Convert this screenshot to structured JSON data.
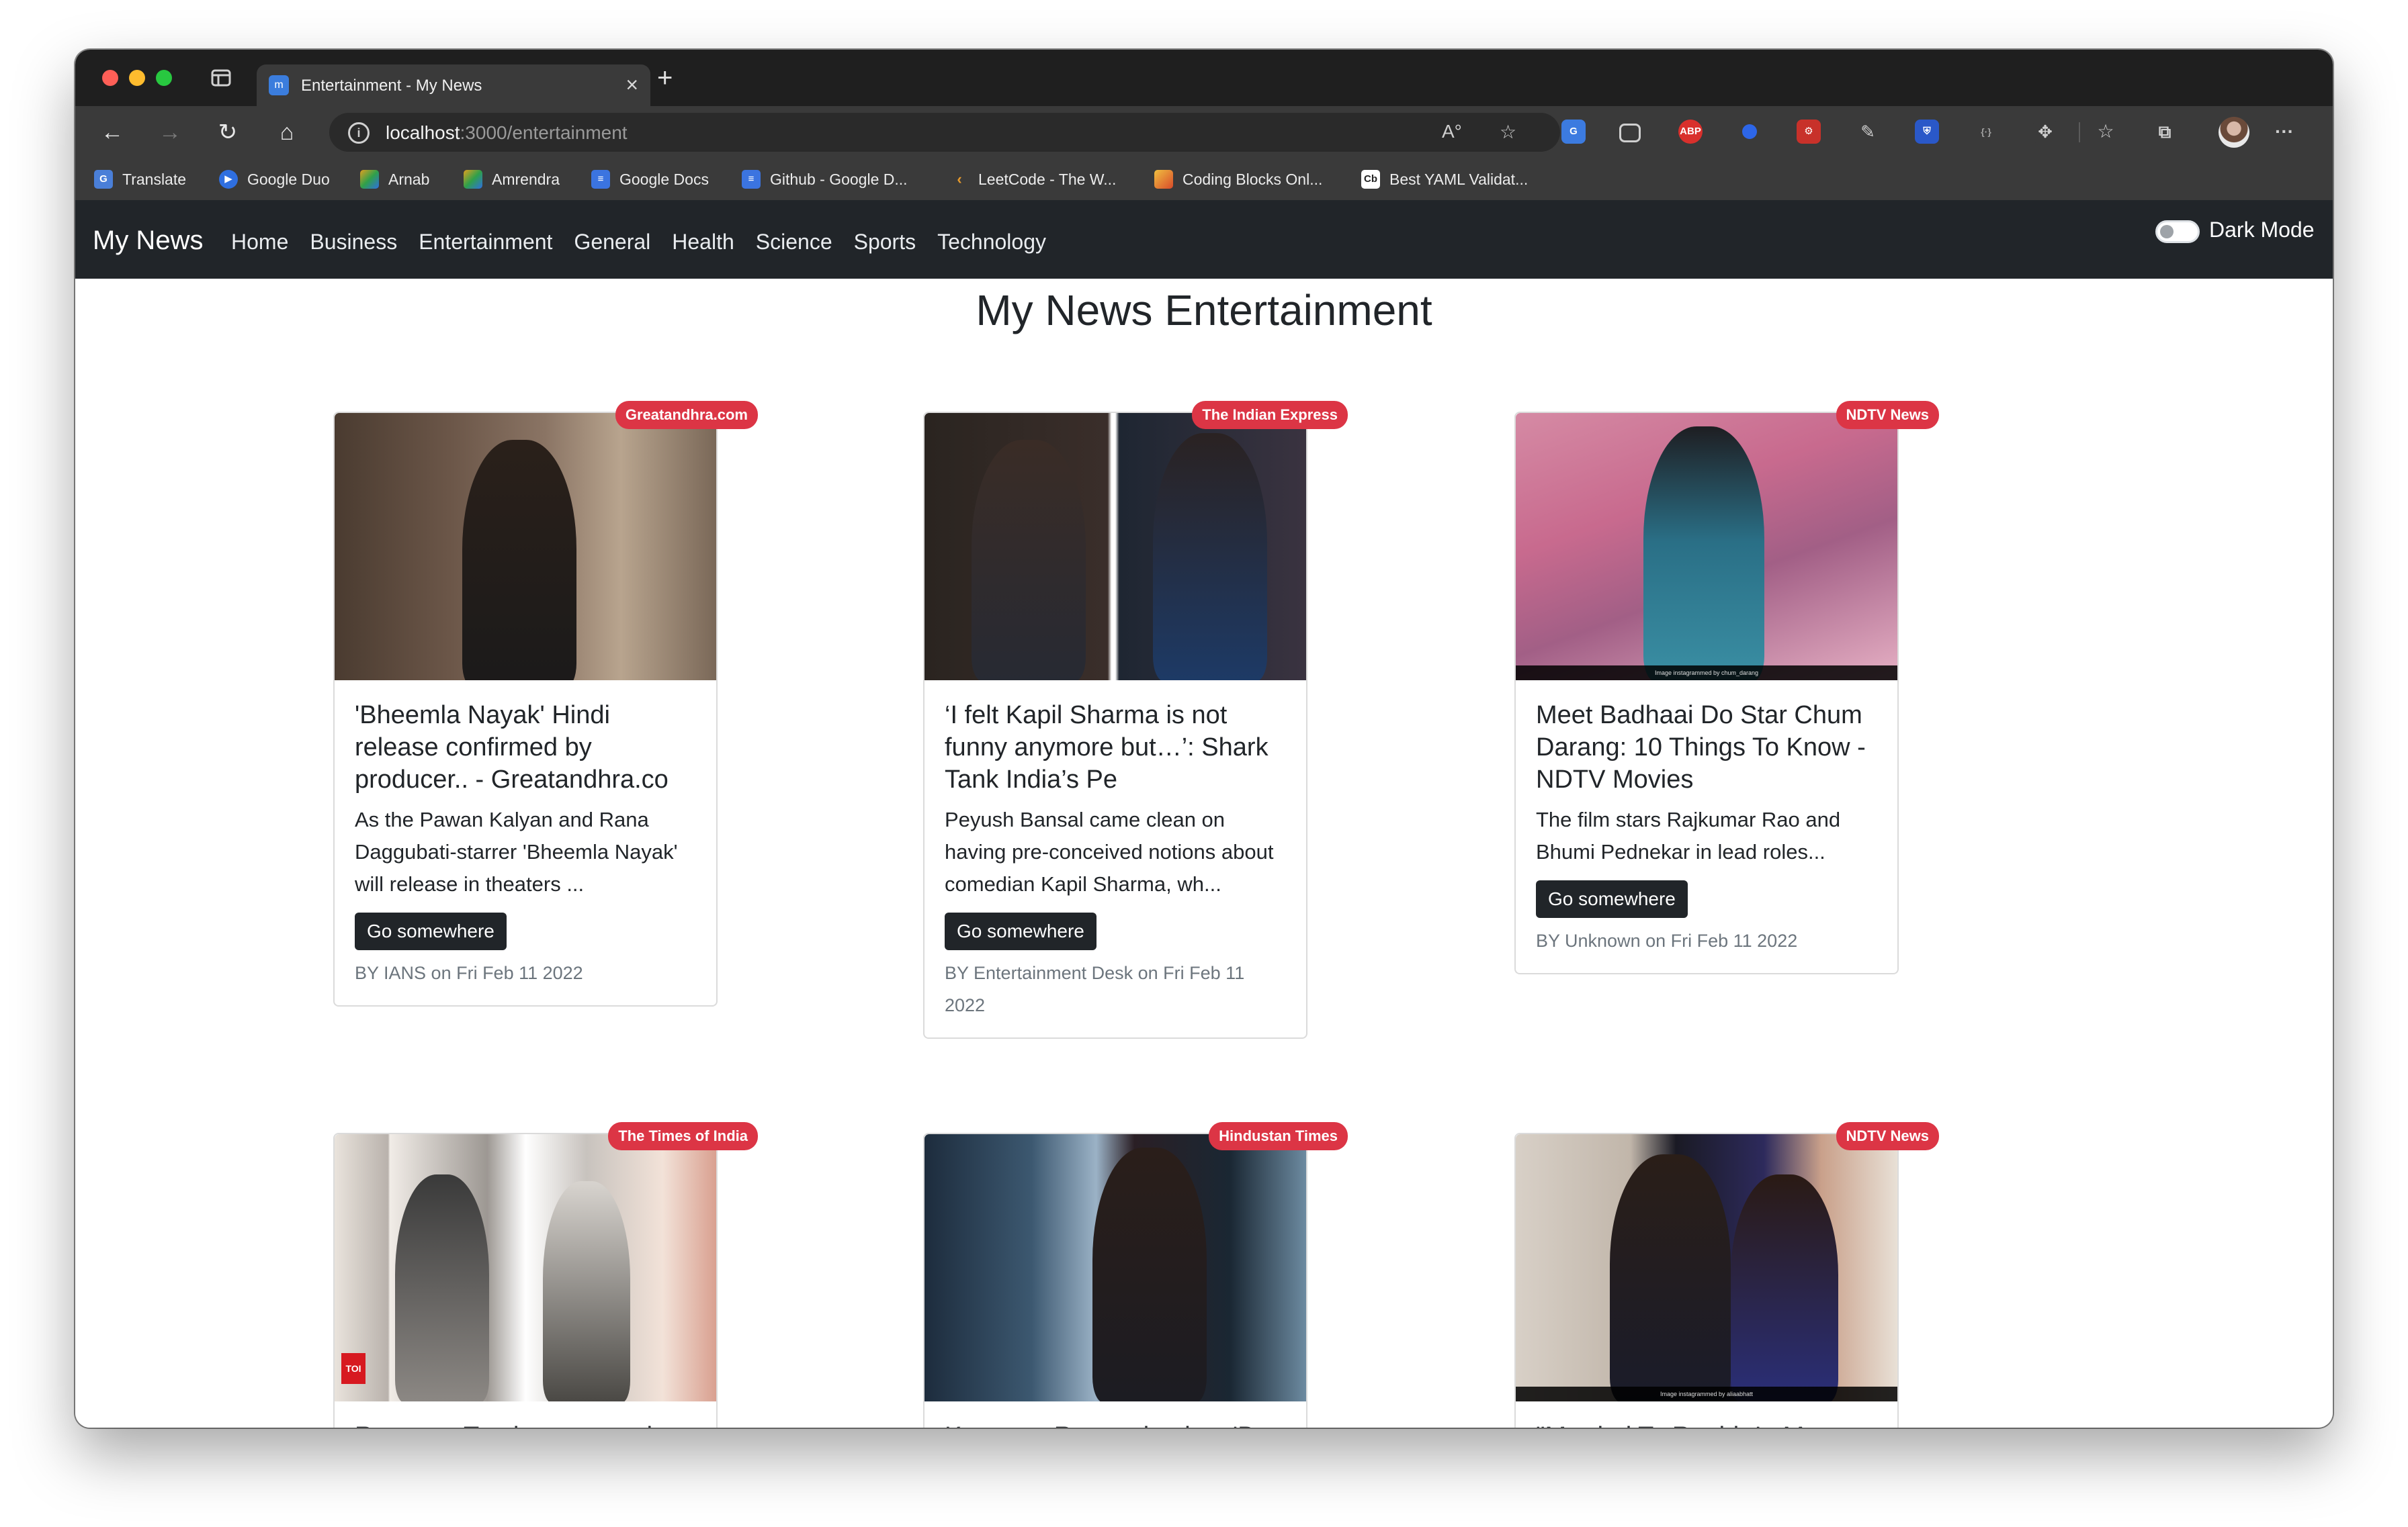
{
  "browser": {
    "tab_title": "Entertainment - My News",
    "url_host": "localhost",
    "url_path": ":3000/entertainment",
    "tab_favicon_letter": "m",
    "bookmarks": [
      {
        "label": "Translate",
        "icon": "translate-icon",
        "color": "#4a7fd8"
      },
      {
        "label": "Google Duo",
        "icon": "duo-icon",
        "color": "#2f6fe0"
      },
      {
        "label": "Arnab",
        "icon": "bookmark-folder-icon",
        "color": "#e0a020"
      },
      {
        "label": "Amrendra",
        "icon": "bookmark-folder-icon",
        "color": "#e0a020"
      },
      {
        "label": "Google Docs",
        "icon": "docs-icon",
        "color": "#3b74e0"
      },
      {
        "label": "Github - Google D...",
        "icon": "docs-icon",
        "color": "#3b74e0"
      },
      {
        "label": "LeetCode - The W...",
        "icon": "leetcode-icon",
        "color": "#e89b2c"
      },
      {
        "label": "Coding Blocks Onl...",
        "icon": "cube-icon",
        "color": "#d84a2a"
      },
      {
        "label": "Best YAML Validat...",
        "icon": "cb-icon",
        "color": "#ffffff"
      }
    ]
  },
  "app": {
    "brand": "My News",
    "nav": [
      "Home",
      "Business",
      "Entertainment",
      "General",
      "Health",
      "Science",
      "Sports",
      "Technology"
    ],
    "dark_mode_label": "Dark Mode",
    "dark_mode_on": false,
    "heading": "My News Entertainment",
    "button_label": "Go somewhere",
    "badge_color": "#dc3545"
  },
  "articles": [
    {
      "source": "Greatandhra.com",
      "title": "'Bheemla Nayak' Hindi release confirmed by producer.. - Greatandhra.co",
      "description": "As the Pawan Kalyan and Rana Daggubati-starrer 'Bheemla Nayak' will release in theaters ...",
      "meta": "BY IANS on Fri Feb 11 2022"
    },
    {
      "source": "The Indian Express",
      "title": "‘I felt Kapil Sharma is not funny anymore but…’: Shark Tank India’s Pe",
      "description": "Peyush Bansal came clean on having pre-conceived notions about comedian Kapil Sharma, wh...",
      "meta": "BY Entertainment Desk on Fri Feb 11 2022"
    },
    {
      "source": "NDTV News",
      "title": "Meet Badhaai Do Star Chum Darang: 10 Things To Know - NDTV Movies",
      "description": "The film stars Rajkumar Rao and Bhumi Pednekar in lead roles...",
      "meta": "BY Unknown on Fri Feb 11 2022",
      "image_caption": "Image instagrammed by chum_darang"
    },
    {
      "source": "The Times of India",
      "title": "Raveena Tandon mourns her father Ravi Tandon's",
      "description": "",
      "meta": "",
      "image_logo": "TOI"
    },
    {
      "source": "Hindustan Times",
      "title": "Kangana Ranaut bashes 'B-grade strugglers' who bad-",
      "description": "",
      "meta": ""
    },
    {
      "source": "NDTV News",
      "title": "\"Married To Ranbir In My Head For Many Years\": Alia",
      "description": "",
      "meta": "",
      "image_caption": "Image instagrammed by aliaabhatt"
    }
  ]
}
